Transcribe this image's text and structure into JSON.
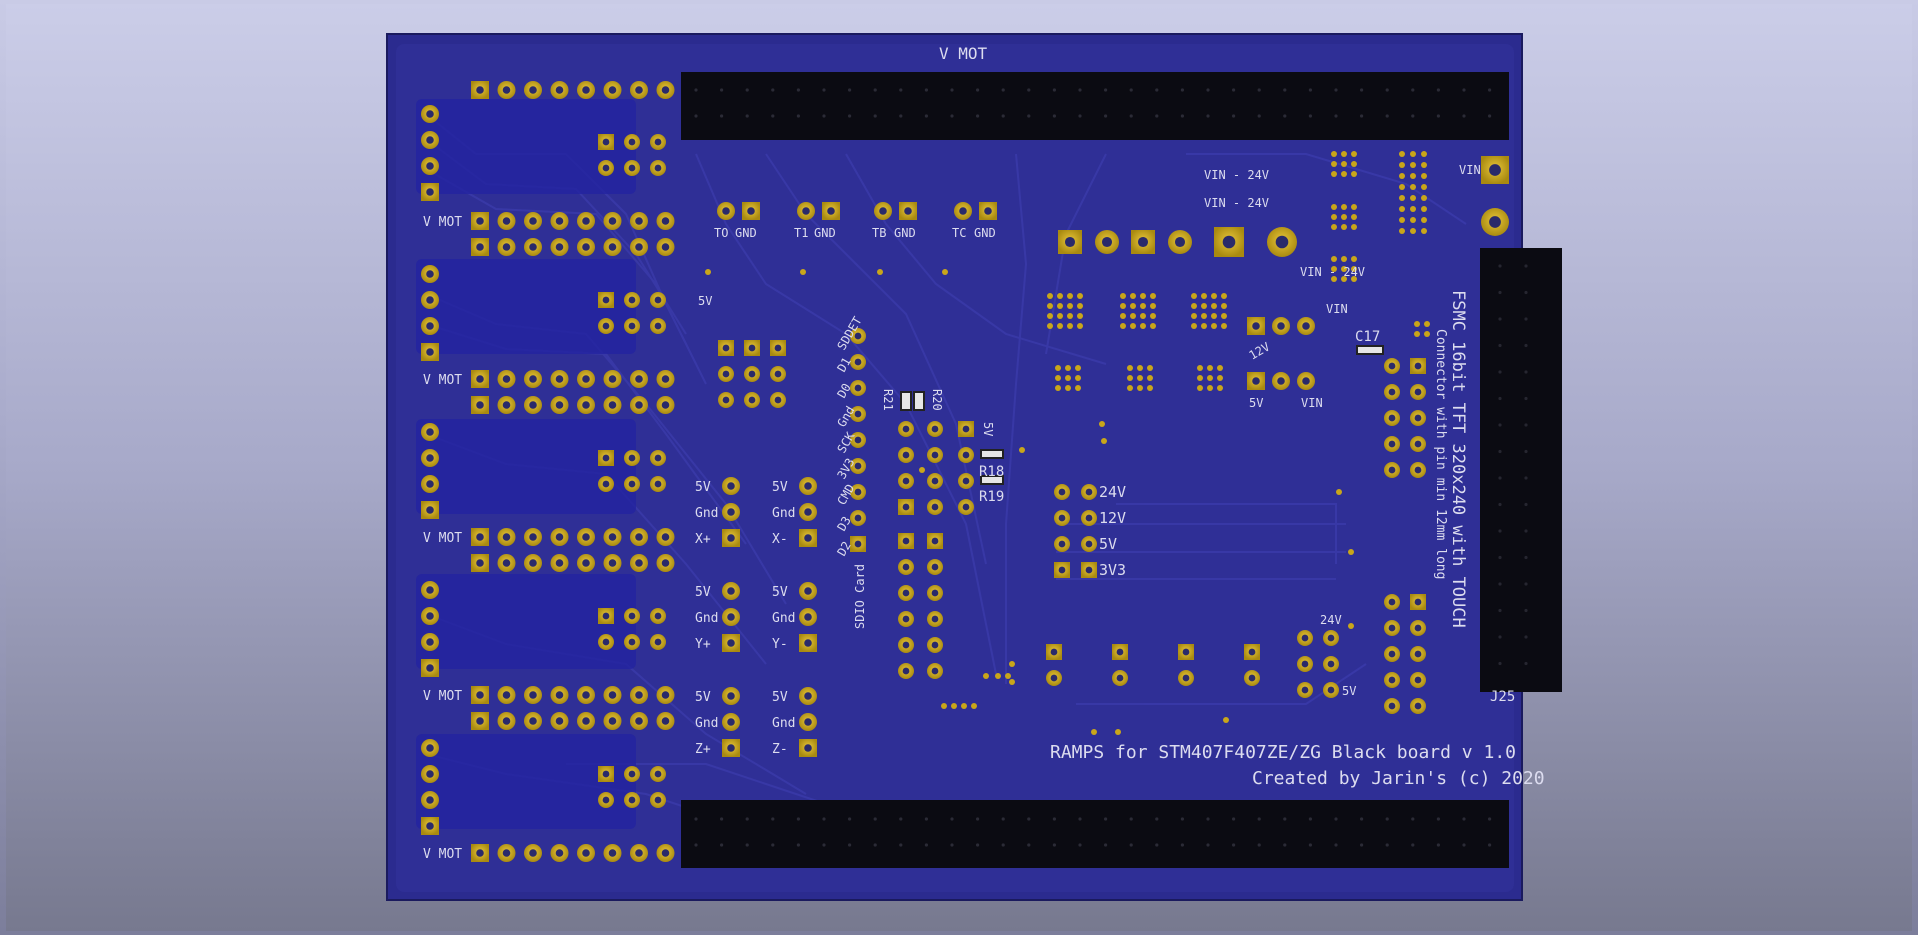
{
  "board": {
    "top_label": "V MOT",
    "vmot_label": "V MOT",
    "title_line1": "RAMPS for STM407F407ZE/ZG Black board v 1.0",
    "title_line2": "Created by Jarin's (c) 2020",
    "fsmc_line1": "FSMC 16bit  TFT 320x240 with TOUCH",
    "fsmc_line2": "Connector with pin min 12mm long",
    "connector_ref": "J25",
    "sdio_label": "SDIO Card",
    "sdio_pins": [
      "SDDET",
      "D1",
      "D0",
      "Gnd",
      "SCK",
      "3V3",
      "CMD",
      "D3",
      "D2"
    ],
    "thermistors": [
      {
        "a": "TO",
        "b": "GND"
      },
      {
        "a": "T1",
        "b": "GND"
      },
      {
        "a": "TB",
        "b": "GND"
      },
      {
        "a": "TC",
        "b": "GND"
      }
    ],
    "endstop_groups": [
      [
        "5V",
        "Gnd",
        "X+"
      ],
      [
        "5V",
        "Gnd",
        "X-"
      ],
      [
        "5V",
        "Gnd",
        "Y+"
      ],
      [
        "5V",
        "Gnd",
        "Y-"
      ],
      [
        "5V",
        "Gnd",
        "Z+"
      ],
      [
        "5V",
        "Gnd",
        "Z-"
      ]
    ],
    "power_rails": [
      "24V",
      "12V",
      "5V",
      "3V3"
    ],
    "vin_24v_labels": [
      "VIN - 24V",
      "VIN - 24V",
      "VIN - 24V"
    ],
    "misc": {
      "vin": "VIN",
      "vin2": "VIN",
      "vin3": "VIN",
      "v12": "12V",
      "v5": "5V",
      "v24": "24V",
      "v5b": "5V",
      "v5c": "5V",
      "c17": "C17",
      "r21": "R21",
      "r20": "R20",
      "r18": "R18",
      "r19": "R19",
      "sv": "5V"
    }
  },
  "colors": {
    "board": "#2a2a8e",
    "copper": "#c9a61a",
    "silk": "#dcdcef",
    "header": "#0b0b12"
  }
}
